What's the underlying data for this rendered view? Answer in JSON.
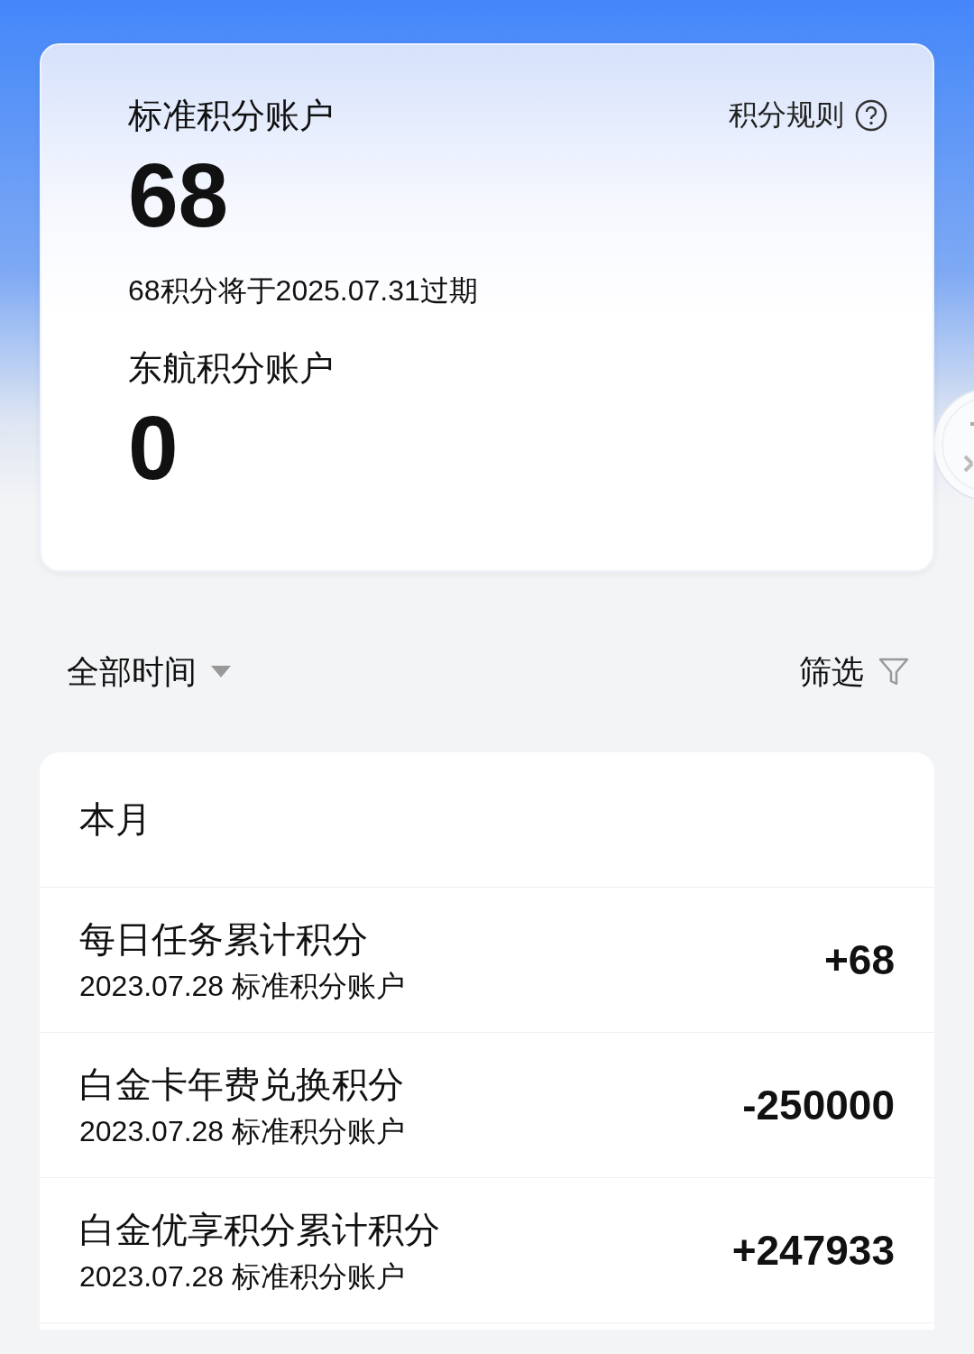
{
  "accounts_card": {
    "rules_link": "积分规则",
    "accounts": [
      {
        "title": "标准积分账户",
        "balance": "68",
        "note": "68积分将于2025.07.31过期"
      },
      {
        "title": "东航积分账户",
        "balance": "0"
      }
    ]
  },
  "filter_bar": {
    "time_range": "全部时间",
    "filter": "筛选"
  },
  "records": {
    "section": "本月",
    "rows": [
      {
        "title": "每日任务累计积分",
        "date": "2023.07.28",
        "account": "标准积分账户",
        "amount": "+68"
      },
      {
        "title": "白金卡年费兑换积分",
        "date": "2023.07.28",
        "account": "标准积分账户",
        "amount": "-250000"
      },
      {
        "title": "白金优享积分累计积分",
        "date": "2023.07.28",
        "account": "标准积分账户",
        "amount": "+247933"
      }
    ]
  }
}
